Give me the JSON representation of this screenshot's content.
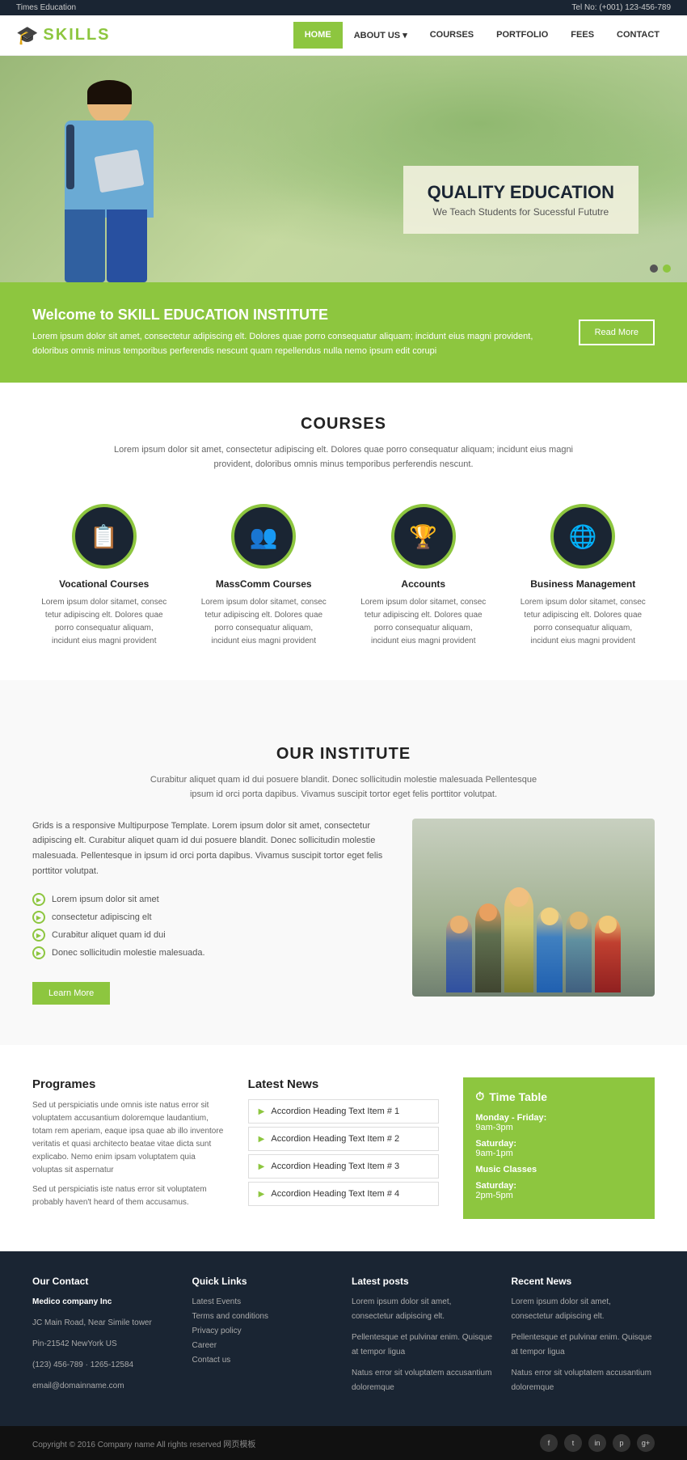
{
  "topbar": {
    "brand": "Times Education",
    "phone_label": "Tel No: (+001) 123-456-789"
  },
  "header": {
    "logo_icon": "🎓",
    "logo_text": "SKILLS",
    "nav": [
      {
        "label": "HOME",
        "active": true
      },
      {
        "label": "ABOUT US",
        "dropdown": true
      },
      {
        "label": "COURSES"
      },
      {
        "label": "PORTFOLIO"
      },
      {
        "label": "FEES"
      },
      {
        "label": "CONTACT"
      }
    ]
  },
  "hero": {
    "title": "QUALITY EDUCATION",
    "subtitle": "We Teach Students for Sucessful Fututre"
  },
  "welcome": {
    "heading": "Welcome to SKILL EDUCATION INSTITUTE",
    "text": "Lorem ipsum dolor sit amet, consectetur adipiscing elt. Dolores quae porro consequatur aliquam; incidunt eius magni provident, doloribus omnis minus temporibus perferendis nescunt quam repellendus nulla nemo ipsum edit corupi",
    "btn_label": "Read More"
  },
  "courses": {
    "section_title": "COURSES",
    "section_desc": "Lorem ipsum dolor sit amet, consectetur adipiscing elt. Dolores quae porro consequatur aliquam; incidunt eius magni provident, doloribus omnis minus temporibus perferendis nescunt.",
    "items": [
      {
        "icon": "📋",
        "name": "Vocational Courses",
        "desc": "Lorem ipsum dolor sitamet, consec tetur adipiscing elt. Dolores quae porro consequatur aliquam, incidunt eius magni provident"
      },
      {
        "icon": "👥",
        "name": "MassComm Courses",
        "desc": "Lorem ipsum dolor sitamet, consec tetur adipiscing elt. Dolores quae porro consequatur aliquam, incidunt eius magni provident"
      },
      {
        "icon": "🏆",
        "name": "Accounts",
        "desc": "Lorem ipsum dolor sitamet, consec tetur adipiscing elt. Dolores quae porro consequatur aliquam, incidunt eius magni provident"
      },
      {
        "icon": "🌐",
        "name": "Business Management",
        "desc": "Lorem ipsum dolor sitamet, consec tetur adipiscing elt. Dolores quae porro consequatur aliquam, incidunt eius magni provident"
      }
    ]
  },
  "institute": {
    "title": "OUR INSTITUTE",
    "desc1": "Curabitur aliquet quam id dui posuere blandit. Donec sollicitudin molestie malesuada Pellentesque ipsum id orci porta dapibus. Vivamus suscipit tortor eget felis porttitor volutpat.",
    "desc2": "Grids is a responsive Multipurpose Template. Lorem ipsum dolor sit amet, consectetur adipiscing elt. Curabitur aliquet quam id dui posuere blandit. Donec sollicitudin molestie malesuada. Pellentesque in ipsum id orci porta dapibus. Vivamus suscipit tortor eget felis porttitor volutpat.",
    "list_items": [
      "Lorem ipsum dolor sit amet",
      "consectetur adipiscing elt",
      "Curabitur aliquet quam id dui",
      "Donec sollicitudin molestie malesuada."
    ],
    "btn_label": "Learn More"
  },
  "programes": {
    "title": "Programes",
    "text1": "Sed ut perspiciatis unde omnis iste natus error sit voluptatem accusantium doloremque laudantium, totam rem aperiam, eaque ipsa quae ab illo inventore veritatis et quasi architecto beatae vitae dicta sunt explicabo. Nemo enim ipsam voluptatem quia voluptas sit aspernatur",
    "text2": "Sed ut perspiciatis iste natus error sit voluptatem probably haven't heard of them accusamus."
  },
  "latest_news": {
    "title": "Latest News",
    "items": [
      "Accordion Heading Text Item # 1",
      "Accordion Heading Text Item # 2",
      "Accordion Heading Text Item # 3",
      "Accordion Heading Text Item # 4"
    ]
  },
  "timetable": {
    "title": "Time Table",
    "icon": "⏱",
    "entries": [
      {
        "day": "Monday - Friday:",
        "time": "9am-3pm"
      },
      {
        "day": "Saturday:",
        "time": "9am-1pm"
      },
      {
        "day": "Music Classes",
        "time": ""
      },
      {
        "day": "Saturday:",
        "time": "2pm-5pm"
      }
    ]
  },
  "footer": {
    "contact": {
      "title": "Our Contact",
      "company": "Medico company Inc",
      "address1": "JC Main Road, Near Simile tower",
      "address2": "Pin-21542 NewYork US",
      "phone1": "(123) 456-789 · 1265-12584",
      "email": "email@domainname.com"
    },
    "quick_links": {
      "title": "Quick Links",
      "links": [
        "Latest Events",
        "Terms and conditions",
        "Privacy policy",
        "Career",
        "Contact us"
      ]
    },
    "latest_posts": {
      "title": "Latest posts",
      "text1": "Lorem ipsum dolor sit amet, consectetur adipiscing elt.",
      "text2": "Pellentesque et pulvinar enim. Quisque at tempor ligua",
      "text3": "Natus error sit voluptatem accusantium doloremque"
    },
    "recent_news": {
      "title": "Recent News",
      "text1": "Lorem ipsum dolor sit amet, consectetur adipiscing elt.",
      "text2": "Pellentesque et pulvinar enim. Quisque at tempor ligua",
      "text3": "Natus error sit voluptatem accusantium doloremque"
    }
  },
  "bottom_bar": {
    "copyright": "Copyright © 2016 Company name All rights reserved 网页模板",
    "social": [
      "f",
      "t",
      "in",
      "p",
      "g+"
    ]
  }
}
